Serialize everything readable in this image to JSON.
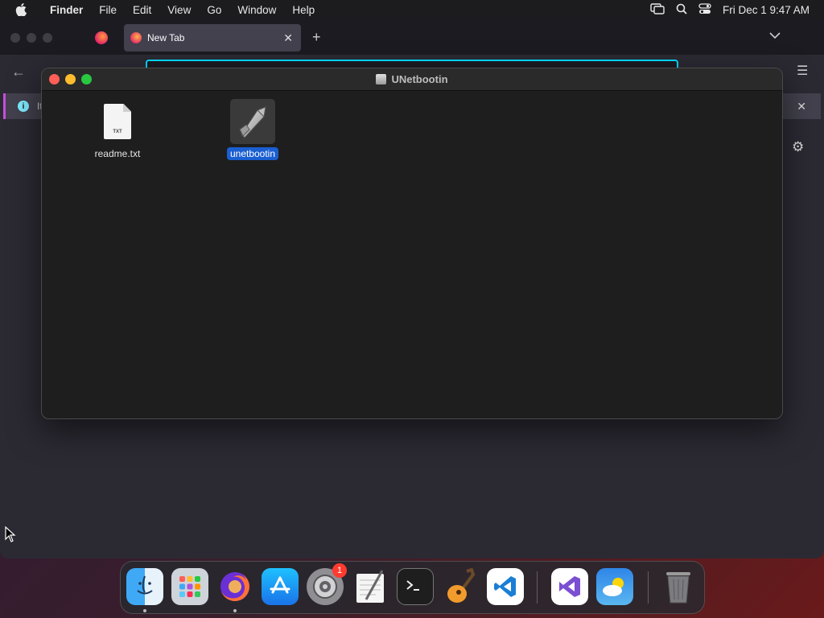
{
  "menubar": {
    "app_name": "Finder",
    "items": [
      "File",
      "Edit",
      "View",
      "Go",
      "Window",
      "Help"
    ],
    "clock": "Fri Dec 1  9:47 AM"
  },
  "browser": {
    "tab_title": "New Tab",
    "notification_text": "It"
  },
  "finder": {
    "title": "UNetbootin",
    "files": [
      {
        "name": "readme.txt",
        "doc_label": "TXT"
      },
      {
        "name": "unetbootin"
      }
    ]
  },
  "dock": {
    "apps": [
      "Finder",
      "Launchpad",
      "Firefox",
      "App Store",
      "System Preferences",
      "TextEdit",
      "Terminal",
      "GarageBand",
      "Visual Studio Code",
      "Visual Studio",
      "Weather",
      "Trash"
    ],
    "system_preferences_badge": "1"
  }
}
